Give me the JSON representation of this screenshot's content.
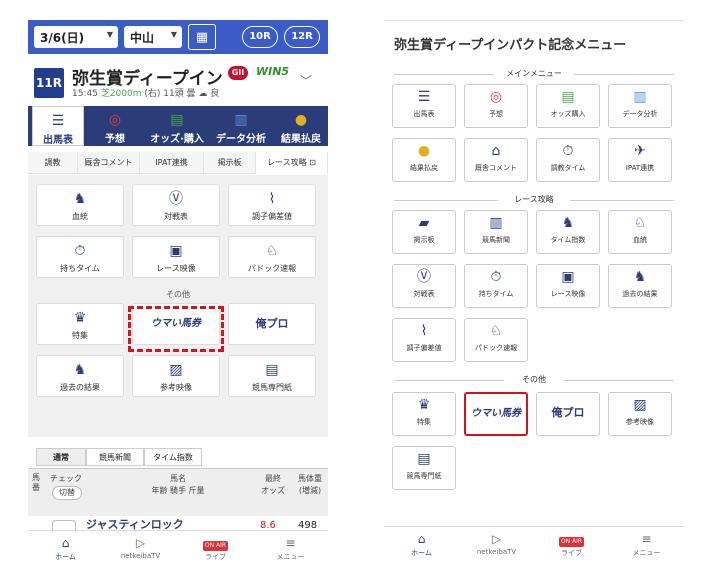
{
  "left": {
    "date_select": "3/6(日)",
    "venue_select": "中山",
    "pill_10r": "10R",
    "pill_12r": "12R",
    "race_no": "11R",
    "race_name": "弥生賞ディープイン",
    "grade": "GII",
    "win5": "WIN5",
    "race_info_time": "15:45",
    "race_info_track": "芝2000m",
    "race_info_rest": "(右) 11頭 曇 ☁ 良",
    "main_nav": [
      "出馬表",
      "予想",
      "オッズ·購入",
      "データ分析",
      "結果払戻"
    ],
    "sub_tabs": [
      "調教",
      "厩舎コメント",
      "IPAT連携",
      "掲示板",
      "レース攻略"
    ],
    "cards_row1": [
      "血統",
      "対戦表",
      "調子偏差値"
    ],
    "cards_row2": [
      "持ちタイム",
      "レース映像",
      "パドック速報"
    ],
    "sono_ta": "その他",
    "cards_row3": [
      "特集",
      "ウマい馬券",
      "俺プロ"
    ],
    "cards_row4": [
      "過去の結果",
      "参考映像",
      "競馬専門紙"
    ],
    "bottom_tabs": [
      "通常",
      "競馬新聞",
      "タイム指数"
    ],
    "table_head": {
      "uma": "馬番",
      "check": "チェック",
      "toggle": "切替",
      "name1": "馬名",
      "name2": "年齢 騎手 斤量",
      "odds1": "最終",
      "odds2": "オッズ",
      "weight1": "馬体重",
      "weight2": "(増減)"
    },
    "first_row_name": "ジャスティンロック",
    "first_row_odds": "8.6",
    "first_row_weight": "498"
  },
  "right": {
    "title": "弥生賞ディープインパクト記念メニュー",
    "main_menu_label": "メインメニュー",
    "main_menu": [
      "出馬表",
      "予想",
      "オッズ購入",
      "データ分析",
      "結果払戻",
      "厩舎コメント",
      "調教タイム",
      "IPAT連携",
      "掲示板"
    ],
    "race_label": "レース攻略",
    "race_menu": [
      "競馬新聞",
      "タイム指数",
      "血統",
      "対戦表",
      "持ちタイム",
      "レース映像",
      "過去の結果",
      "調子偏差値",
      "パドック速報"
    ],
    "other_label": "その他",
    "other_menu": [
      "特集",
      "ウマい馬券",
      "俺プロ",
      "参考映像",
      "競馬専門紙"
    ]
  },
  "bottom_nav": [
    "ホーム",
    "netkeibaTV",
    "ライブ",
    "メニュー"
  ],
  "on_air": "ON AIR",
  "colors": {
    "accent": "#3a5cc4",
    "navy": "#2a3d78",
    "highlight": "#d3141f"
  }
}
